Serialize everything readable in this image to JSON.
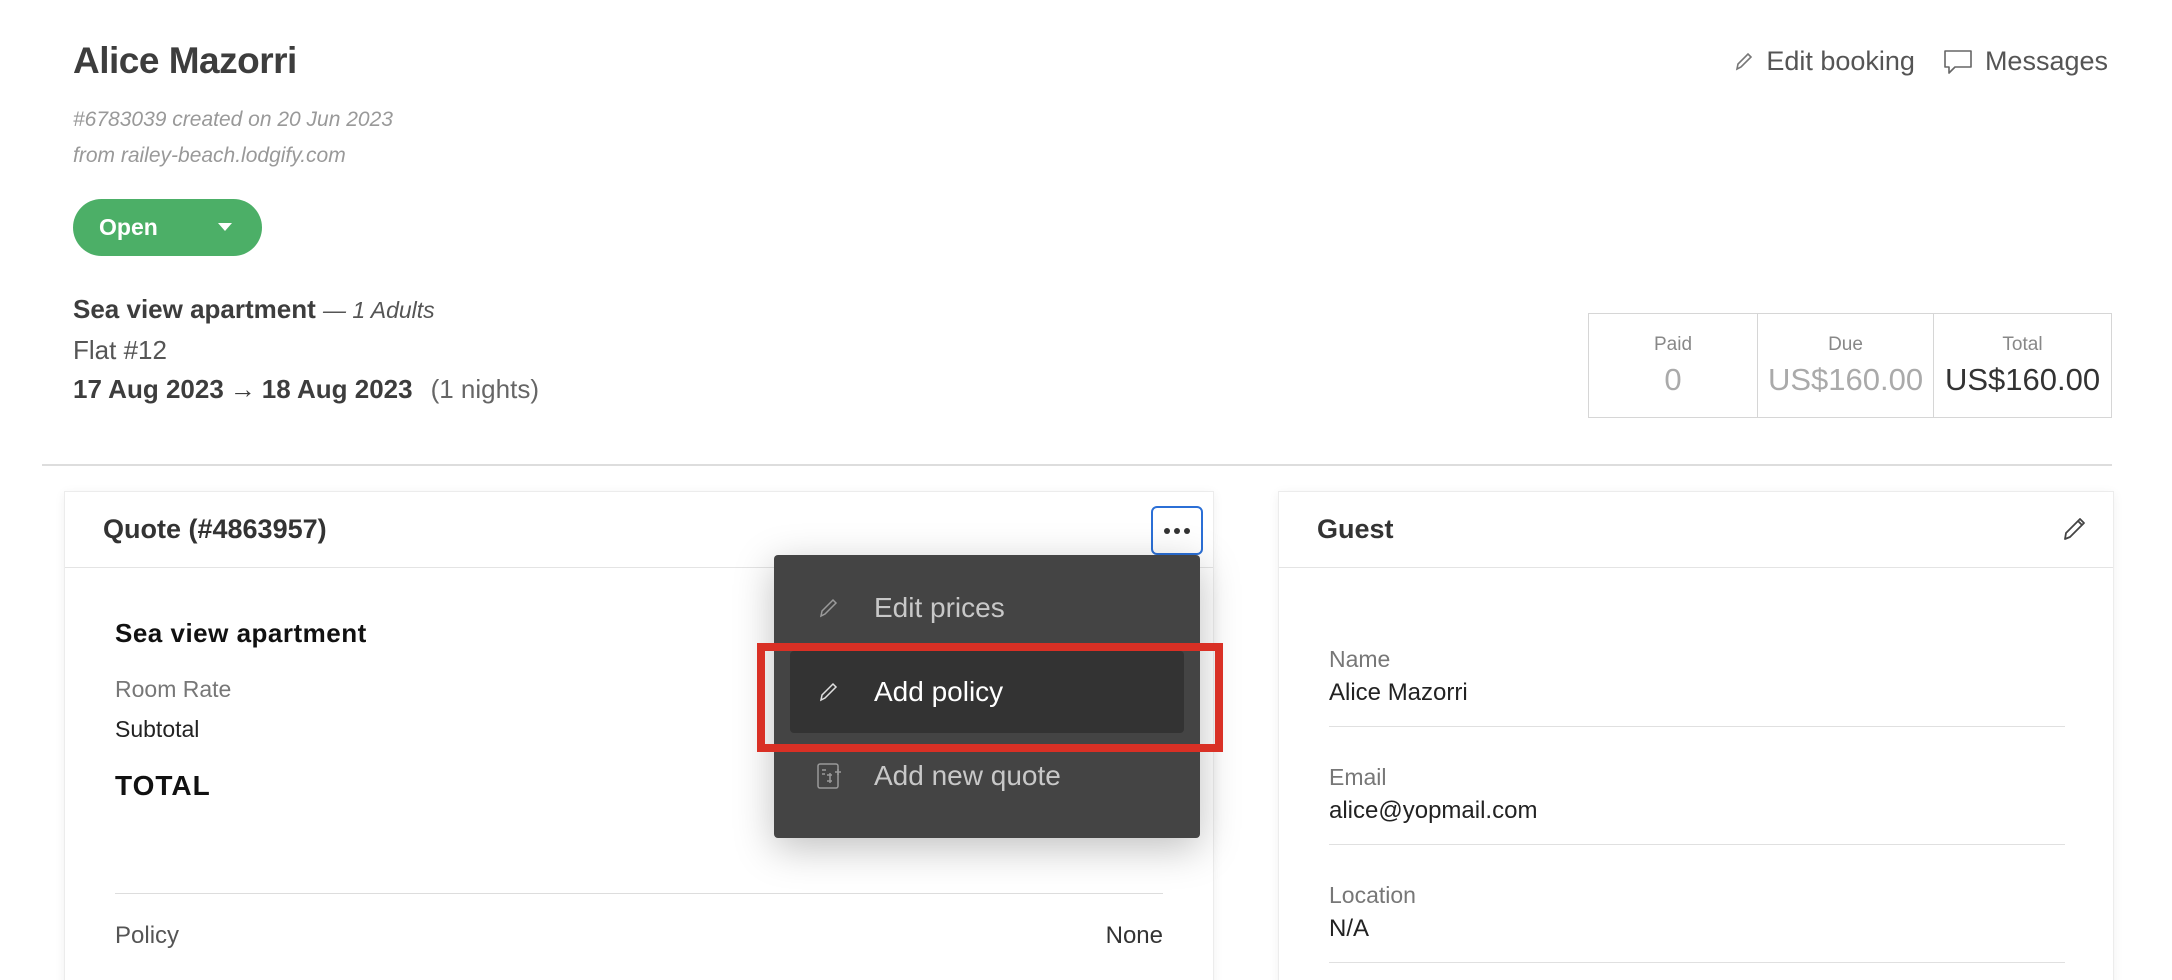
{
  "header": {
    "guest_name": "Alice Mazorri",
    "booking_meta": "#6783039 created on 20 Jun 2023",
    "source": "from railey-beach.lodgify.com",
    "actions": {
      "edit_booking": "Edit booking",
      "messages": "Messages"
    }
  },
  "status": {
    "label": "Open"
  },
  "booking": {
    "property": "Sea view apartment",
    "guests": "— 1 Adults",
    "unit": "Flat #12",
    "check_in": "17 Aug 2023",
    "arrow": "→",
    "check_out": "18 Aug 2023",
    "nights": "(1 nights)"
  },
  "totals": {
    "paid_label": "Paid",
    "paid_value": "0",
    "due_label": "Due",
    "due_value": "US$160.00",
    "total_label": "Total",
    "total_value": "US$160.00"
  },
  "quote_card": {
    "title": "Quote (#4863957)",
    "property": "Sea view apartment",
    "room_rate": "Room Rate",
    "subtotal": "Subtotal",
    "total": "TOTAL",
    "policy_label": "Policy",
    "policy_value": "None"
  },
  "menu": {
    "items": [
      {
        "label": "Edit prices",
        "icon": "pencil-icon"
      },
      {
        "label": "Add policy",
        "icon": "pencil-icon"
      },
      {
        "label": "Add new quote",
        "icon": "quote-document-icon"
      }
    ]
  },
  "guest_card": {
    "title": "Guest",
    "fields": [
      {
        "label": "Name",
        "value": "Alice Mazorri"
      },
      {
        "label": "Email",
        "value": "alice@yopmail.com"
      },
      {
        "label": "Location",
        "value": "N/A"
      }
    ]
  },
  "colors": {
    "status_green": "#4caf67",
    "menu_bg": "#444444",
    "menu_active": "#333333",
    "focus_blue": "#2b6fd6",
    "highlight_red": "#d93025"
  }
}
